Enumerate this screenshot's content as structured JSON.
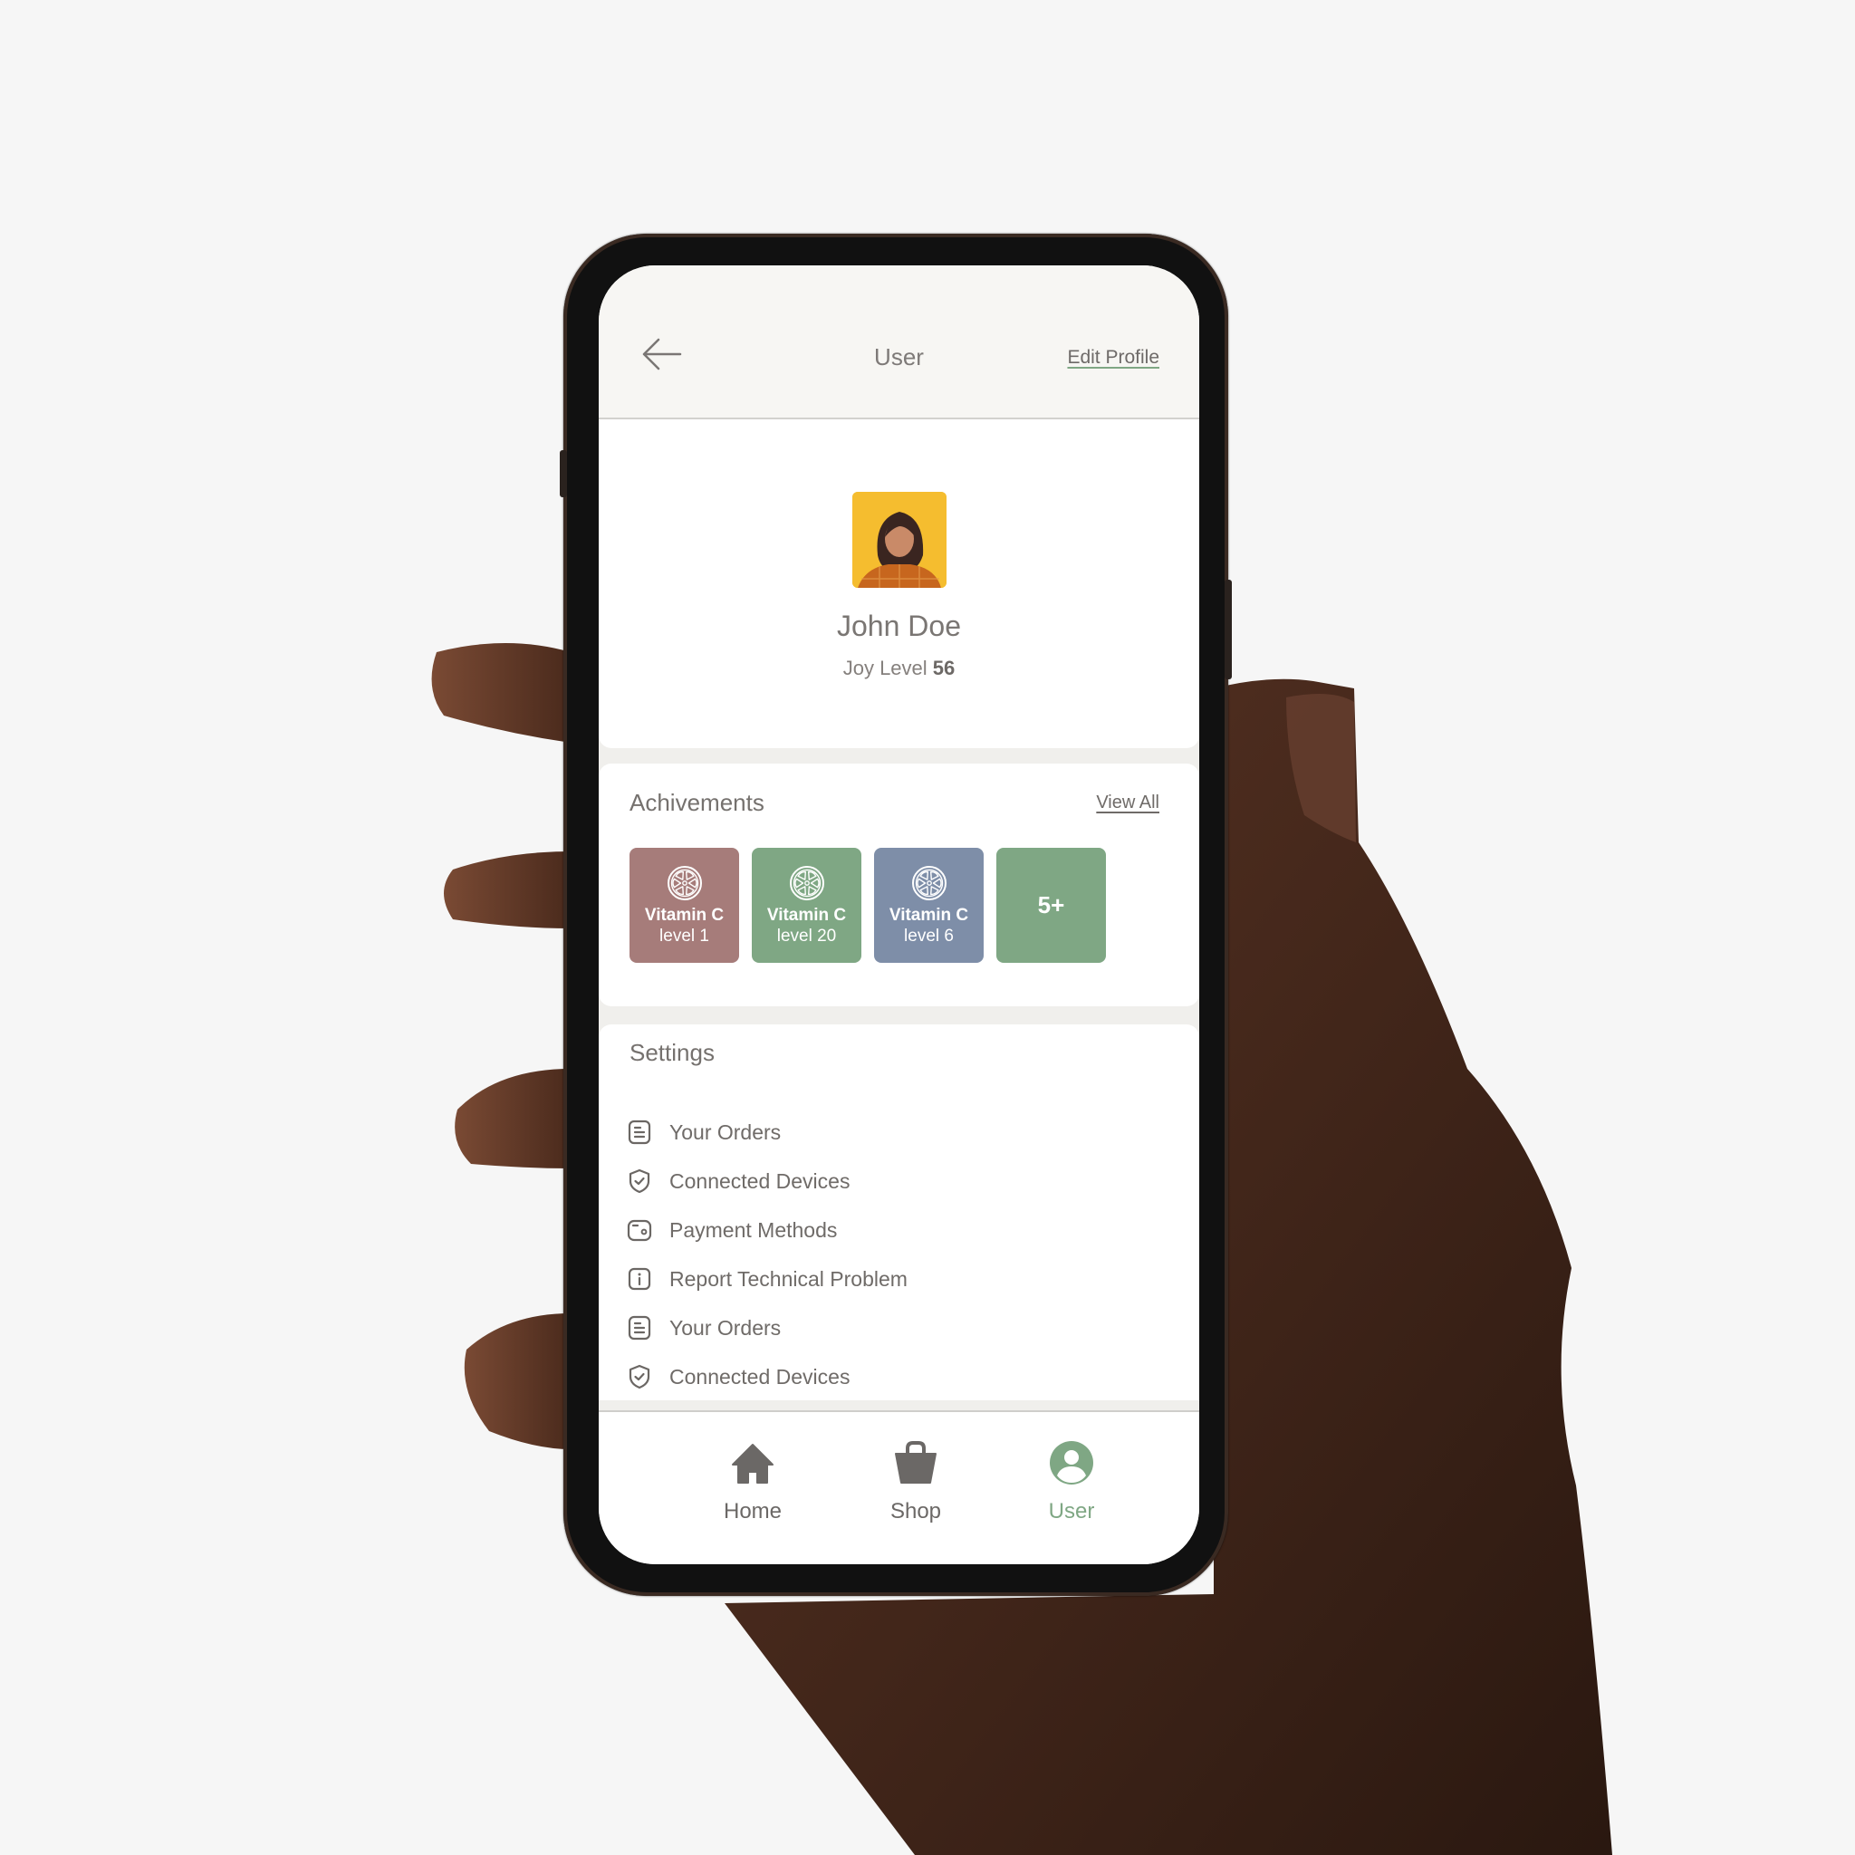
{
  "header": {
    "title": "User",
    "back_icon": "arrow-left-icon",
    "edit_profile_label": "Edit Profile"
  },
  "profile": {
    "name": "John Doe",
    "joy_level_label": "Joy Level",
    "joy_level_value": "56",
    "avatar_bg_color": "#f5bd2f"
  },
  "achievements": {
    "title": "Achivements",
    "view_all_label": "View All",
    "badges": [
      {
        "title": "Vitamin C",
        "level": "level 1",
        "color": "#a67c7a",
        "icon": "citrus-slice-icon"
      },
      {
        "title": "Vitamin C",
        "level": "level 20",
        "color": "#7fa784",
        "icon": "citrus-slice-icon"
      },
      {
        "title": "Vitamin C",
        "level": "level 6",
        "color": "#7e8ea8",
        "icon": "citrus-slice-icon"
      }
    ],
    "more": {
      "label": "5+",
      "color": "#7fa784"
    }
  },
  "settings": {
    "title": "Settings",
    "items": [
      {
        "label": "Your Orders",
        "icon": "receipt-icon"
      },
      {
        "label": "Connected Devices",
        "icon": "shield-check-icon"
      },
      {
        "label": "Payment Methods",
        "icon": "wallet-icon"
      },
      {
        "label": "Report Technical Problem",
        "icon": "info-icon"
      },
      {
        "label": "Your Orders",
        "icon": "receipt-icon"
      },
      {
        "label": "Connected Devices",
        "icon": "shield-check-icon"
      }
    ]
  },
  "bottom_nav": {
    "items": [
      {
        "label": "Home",
        "icon": "home-icon",
        "active": false
      },
      {
        "label": "Shop",
        "icon": "shopping-bag-icon",
        "active": false
      },
      {
        "label": "User",
        "icon": "user-circle-icon",
        "active": true
      }
    ],
    "active_color": "#7fa784",
    "inactive_color": "#6b6866"
  }
}
